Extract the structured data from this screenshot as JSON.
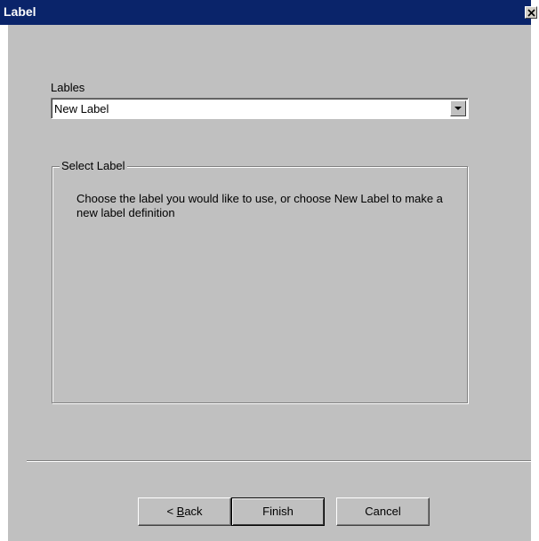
{
  "window": {
    "title": "Label",
    "close_label": "×"
  },
  "labels_field": {
    "label": "Lables",
    "value": "New Label"
  },
  "select_group": {
    "legend": "Select Label",
    "description": "Choose the label you would like to use, or choose New Label to make a new label definition"
  },
  "buttons": {
    "back": "< Back",
    "back_prefix": "< ",
    "back_mnemonic": "B",
    "back_rest": "ack",
    "finish": "Finish",
    "cancel": "Cancel"
  },
  "colors": {
    "titlebar": "#0a246a",
    "dialog_bg": "#c0c0c0",
    "field_bg": "#ffffff"
  },
  "icons": {
    "close": "close-icon",
    "dropdown": "chevron-down-icon"
  }
}
